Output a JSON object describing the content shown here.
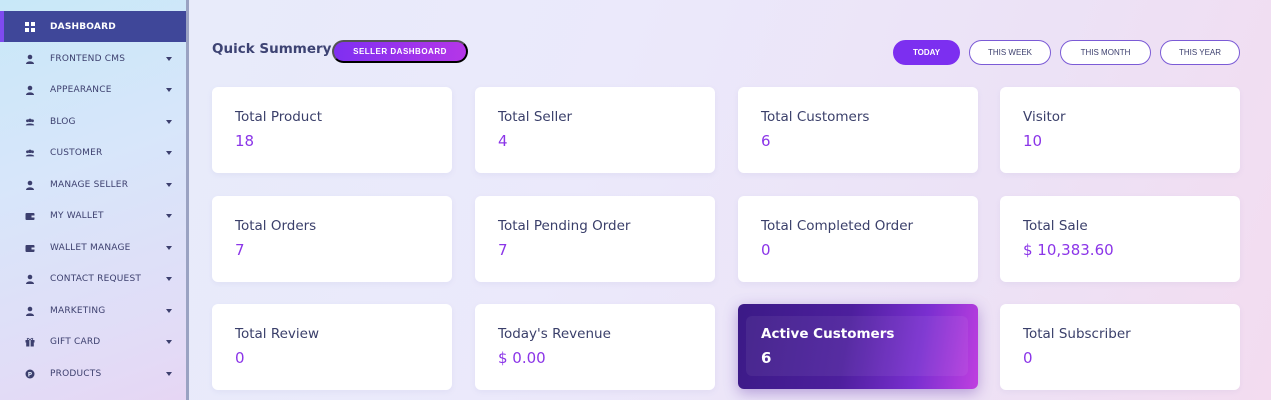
{
  "sidebar": {
    "items": [
      {
        "label": "DASHBOARD",
        "icon": "grid-icon",
        "active": true,
        "dropdown": false
      },
      {
        "label": "FRONTEND CMS",
        "icon": "user-icon",
        "dropdown": true
      },
      {
        "label": "APPEARANCE",
        "icon": "user-icon",
        "dropdown": true
      },
      {
        "label": "BLOG",
        "icon": "users-icon",
        "dropdown": true
      },
      {
        "label": "CUSTOMER",
        "icon": "users-icon",
        "dropdown": true
      },
      {
        "label": "MANAGE SELLER",
        "icon": "user-icon",
        "dropdown": true
      },
      {
        "label": "MY WALLET",
        "icon": "wallet-icon",
        "dropdown": true
      },
      {
        "label": "WALLET MANAGE",
        "icon": "wallet-icon",
        "dropdown": true
      },
      {
        "label": "CONTACT REQUEST",
        "icon": "user-icon",
        "dropdown": true
      },
      {
        "label": "MARKETING",
        "icon": "user-icon",
        "dropdown": true
      },
      {
        "label": "GIFT CARD",
        "icon": "gift-icon",
        "dropdown": true
      },
      {
        "label": "PRODUCTS",
        "icon": "product-icon",
        "dropdown": true
      }
    ]
  },
  "header": {
    "title": "Quick Summery",
    "seller_button": "SELLER DASHBOARD",
    "filters": [
      {
        "label": "TODAY",
        "active": true
      },
      {
        "label": "THIS WEEK",
        "active": false
      },
      {
        "label": "THIS MONTH",
        "active": false
      },
      {
        "label": "THIS YEAR",
        "active": false
      }
    ]
  },
  "cards": [
    {
      "title": "Total Product",
      "value": "18"
    },
    {
      "title": "Total Seller",
      "value": "4"
    },
    {
      "title": "Total Customers",
      "value": "6"
    },
    {
      "title": "Visitor",
      "value": "10"
    },
    {
      "title": "Total Orders",
      "value": "7"
    },
    {
      "title": "Total Pending Order",
      "value": "7"
    },
    {
      "title": "Total Completed Order",
      "value": "0"
    },
    {
      "title": "Total Sale",
      "value": "$ 10,383.60"
    },
    {
      "title": "Total Review",
      "value": "0"
    },
    {
      "title": "Today's Revenue",
      "value": "$ 0.00"
    },
    {
      "title": "Active Customers",
      "value": "6",
      "highlight": true
    },
    {
      "title": "Total Subscriber",
      "value": "0"
    }
  ],
  "colors": {
    "accent": "#7c2ff0",
    "sidebar_active": "#3f4799",
    "value_text": "#8b35e8"
  }
}
